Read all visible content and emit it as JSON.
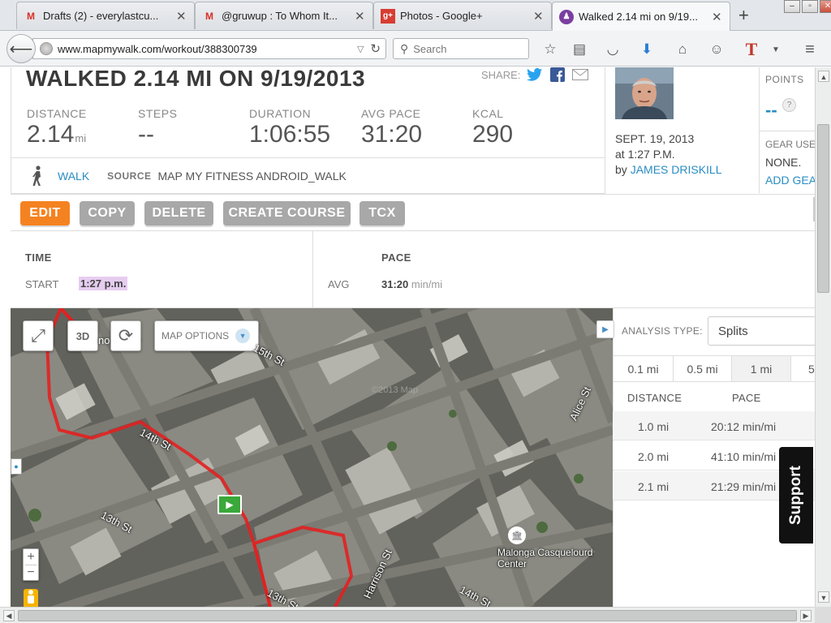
{
  "browser": {
    "tabs": [
      {
        "title": "Drafts (2) - everylastcu...",
        "favicon": "gmail-icon"
      },
      {
        "title": "@gruwup : To Whom It...",
        "favicon": "gmail-icon"
      },
      {
        "title": "Photos - Google+",
        "favicon": "googleplus-icon"
      },
      {
        "title": "Walked 2.14 mi on 9/19...",
        "favicon": "mapmywalk-icon",
        "active": true
      }
    ],
    "url": "www.mapmywalk.com/workout/388300739",
    "search_placeholder": "Search"
  },
  "workout": {
    "title": "WALKED 2.14 MI ON 9/19/2013",
    "share_label": "SHARE:",
    "stats": {
      "distance": {
        "label": "DISTANCE",
        "value": "2.14",
        "unit": "mi"
      },
      "steps": {
        "label": "STEPS",
        "value": "--"
      },
      "duration": {
        "label": "DURATION",
        "value": "1:06:55"
      },
      "avg_pace": {
        "label": "AVG PACE",
        "value": "31:20"
      },
      "kcal": {
        "label": "KCAL",
        "value": "290"
      }
    },
    "activity_type": "WALK",
    "source_label": "SOURCE",
    "source_value": "MAP MY FITNESS ANDROID_WALK"
  },
  "user": {
    "date": "SEPT. 19, 2013",
    "time": "at 1:27 P.M.",
    "by_prefix": "by",
    "name": "JAMES DRISKILL"
  },
  "points": {
    "label": "POINTS",
    "value": "--",
    "help": "?",
    "gear_label": "GEAR USE",
    "gear_value": "NONE.",
    "add_gear": "ADD GEA"
  },
  "actions": {
    "edit": "EDIT",
    "copy": "COPY",
    "delete": "DELETE",
    "create_course": "CREATE COURSE",
    "tcx": "TCX"
  },
  "time_section": {
    "heading": "TIME",
    "start_label": "START",
    "start_value": "1:27 p.m."
  },
  "pace_section": {
    "heading": "PACE",
    "avg_label": "AVG",
    "avg_value": "31:20",
    "avg_unit": "min/mi"
  },
  "map": {
    "options_label": "MAP OPTIONS",
    "btn_3d": "3D",
    "obscured_label": "no      ive",
    "streets": [
      "15th St",
      "14th St",
      "13th St",
      "Alice St",
      "Harrison St",
      "13th St",
      "14th St"
    ],
    "poi": "Malonga Casquelourd Center",
    "zoom_in": "+",
    "zoom_out": "−",
    "watermark": "©2013 Map"
  },
  "analysis": {
    "type_label": "ANALYSIS TYPE:",
    "type_value": "Splits",
    "split_tabs": [
      "0.1 mi",
      "0.5 mi",
      "1 mi",
      "5"
    ],
    "col_distance": "DISTANCE",
    "col_pace": "PACE",
    "rows": [
      {
        "distance": "1.0 mi",
        "pace": "20:12 min/mi"
      },
      {
        "distance": "2.0 mi",
        "pace": "41:10 min/mi"
      },
      {
        "distance": "2.1 mi",
        "pace": "21:29 min/mi"
      }
    ]
  },
  "support_label": "Support",
  "colors": {
    "accent_orange": "#f58220",
    "link_blue": "#2a8dc3",
    "route_red": "#e32020",
    "start_green": "#3aa83a"
  }
}
